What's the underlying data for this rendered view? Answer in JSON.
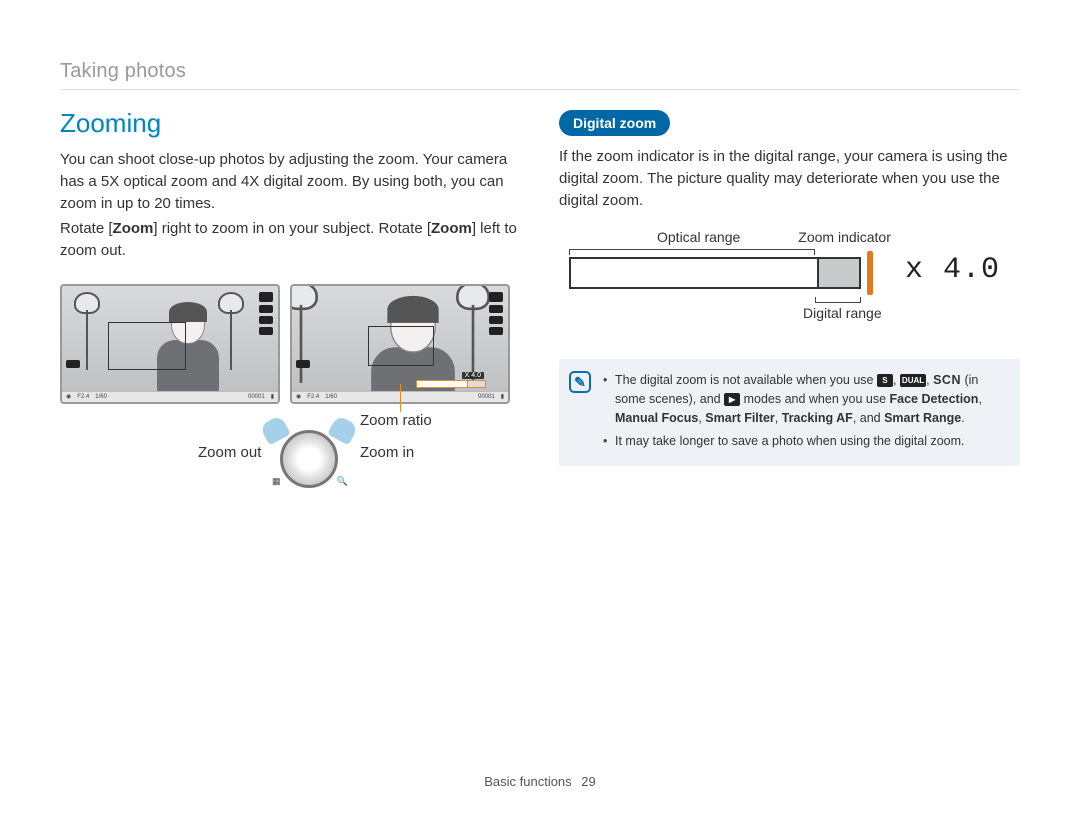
{
  "header": {
    "breadcrumb": "Taking photos"
  },
  "left": {
    "title": "Zooming",
    "para1": "You can shoot close-up photos by adjusting the zoom. Your camera has a 5X optical zoom and 4X digital zoom. By using both, you can zoom in up to 20 times.",
    "para2_pre": "Rotate [",
    "para2_bold1": "Zoom",
    "para2_mid": "] right to zoom in on your subject. Rotate [",
    "para2_bold2": "Zoom",
    "para2_post": "] left to zoom out.",
    "lcd_bottom": {
      "aperture": "F2.4",
      "shutter": "1/60",
      "counter": "00001"
    },
    "zoom_x_badge": "X 4.0",
    "labels": {
      "zoom_ratio": "Zoom ratio",
      "zoom_out": "Zoom out",
      "zoom_in": "Zoom in"
    }
  },
  "right": {
    "pill": "Digital zoom",
    "para": "If the zoom indicator is in the digital range, your camera is using the digital zoom. The picture quality may deteriorate when you use the digital zoom.",
    "diagram": {
      "optical_label": "Optical range",
      "indicator_label": "Zoom indicator",
      "digital_label": "Digital range",
      "x_value": "4.0"
    },
    "note": {
      "bullet1_pre": "The digital zoom is not available when you use ",
      "bullet1_mid": " (in some scenes), and ",
      "bullet1_mid2": " modes and when you use ",
      "bullet1_b1": "Face Detection",
      "bullet1_sep": ", ",
      "bullet1_b2": "Manual Focus",
      "bullet1_b3": "Smart Filter",
      "bullet1_b4": "Tracking AF",
      "bullet1_and": ", and ",
      "bullet1_b5": "Smart Range",
      "bullet1_dot": ".",
      "scn": "SCN",
      "dual": "DUAL",
      "bullet2": "It may take longer to save a photo when using the digital zoom."
    }
  },
  "footer": {
    "section": "Basic functions",
    "page": "29"
  }
}
